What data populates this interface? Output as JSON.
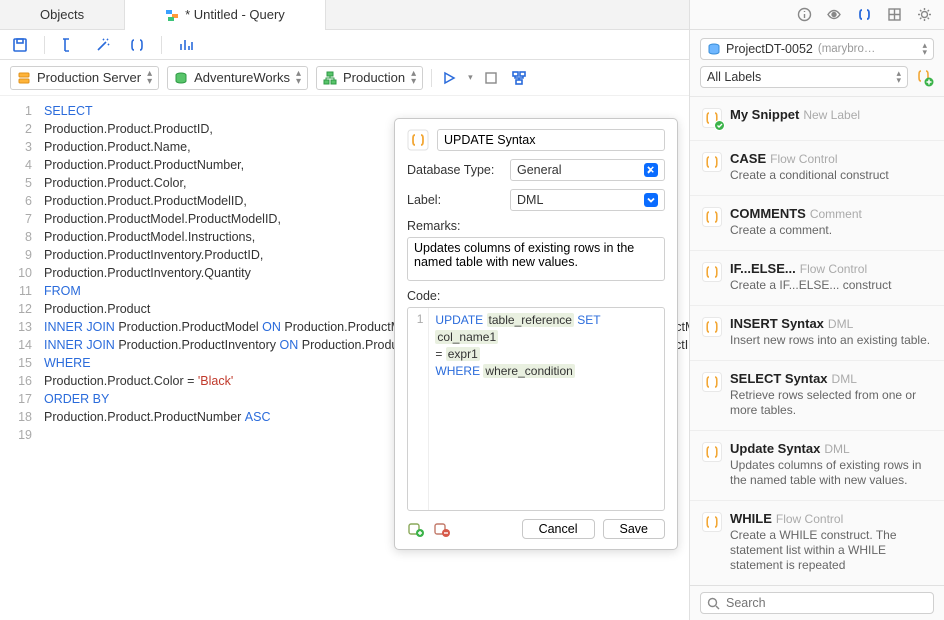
{
  "tabs": {
    "objects": "Objects",
    "query": "* Untitled - Query"
  },
  "toolbar2": {
    "connection": "Production Server",
    "database": "AdventureWorks",
    "schema": "Production"
  },
  "sql": {
    "lines": [
      {
        "n": 1,
        "pre": "",
        "kw": "SELECT",
        "post": ""
      },
      {
        "n": 2,
        "pre": "",
        "kw": "",
        "post": "Production.Product.ProductID,"
      },
      {
        "n": 3,
        "pre": "",
        "kw": "",
        "post": "Production.Product.Name,"
      },
      {
        "n": 4,
        "pre": "",
        "kw": "",
        "post": "Production.Product.ProductNumber,"
      },
      {
        "n": 5,
        "pre": "",
        "kw": "",
        "post": "Production.Product.Color,"
      },
      {
        "n": 6,
        "pre": "",
        "kw": "",
        "post": "Production.Product.ProductModelID,"
      },
      {
        "n": 7,
        "pre": "",
        "kw": "",
        "post": "Production.ProductModel.ProductModelID,"
      },
      {
        "n": 8,
        "pre": "",
        "kw": "",
        "post": "Production.ProductModel.Instructions,"
      },
      {
        "n": 9,
        "pre": "",
        "kw": "",
        "post": "Production.ProductInventory.ProductID,"
      },
      {
        "n": 10,
        "pre": "",
        "kw": "",
        "post": "Production.ProductInventory.Quantity"
      },
      {
        "n": 11,
        "pre": "",
        "kw": "FROM",
        "post": ""
      },
      {
        "n": 12,
        "pre": "",
        "kw": "",
        "post": "Production.Product"
      },
      {
        "n": 13,
        "pre": "",
        "kw": "INNER JOIN",
        "mid": " Production.ProductModel ",
        "kw2": "ON",
        "post": " Production.ProductModel.ProductModelID = Production.Product.ProductModelID"
      },
      {
        "n": 14,
        "pre": "",
        "kw": "INNER JOIN",
        "mid": " Production.ProductInventory ",
        "kw2": "ON",
        "post": " Production.ProductInventory.ProductID = Production.Product.ProductID"
      },
      {
        "n": 15,
        "pre": "",
        "kw": "WHERE",
        "post": ""
      },
      {
        "n": 16,
        "pre": "Production.Product.Color = ",
        "kw": "",
        "str": "'Black'",
        "post": ""
      },
      {
        "n": 17,
        "pre": "",
        "kw": "ORDER BY",
        "post": ""
      },
      {
        "n": 18,
        "pre": "Production.Product.ProductNumber ",
        "kw": "ASC",
        "post": ""
      },
      {
        "n": 19,
        "pre": "",
        "kw": "",
        "post": ""
      }
    ]
  },
  "popup": {
    "title": "UPDATE Syntax",
    "db_type_label": "Database Type:",
    "db_type_value": "General",
    "label_label": "Label:",
    "label_value": "DML",
    "remarks_label": "Remarks:",
    "remarks_value": "Updates columns of existing rows in the named table with new values.",
    "code_label": "Code:",
    "code": {
      "kw1": "UPDATE",
      "ph1": "table_reference",
      "kw2": "SET",
      "ph2": "col_name1",
      "eq": " = ",
      "ph3": "expr1",
      "kw3": "WHERE",
      "ph4": "where_condition"
    },
    "cancel": "Cancel",
    "save": "Save"
  },
  "right": {
    "project": "ProjectDT-0052",
    "project_user": "(marybro…",
    "labels_filter": "All Labels",
    "search_placeholder": "Search",
    "snippets": [
      {
        "title": "My Snippet",
        "tag": "New Label",
        "desc": "",
        "new": true
      },
      {
        "title": "CASE",
        "tag": "Flow Control",
        "desc": "Create a conditional construct"
      },
      {
        "title": "COMMENTS",
        "tag": "Comment",
        "desc": "Create a comment."
      },
      {
        "title": "IF...ELSE...",
        "tag": "Flow Control",
        "desc": "Create a IF...ELSE... construct"
      },
      {
        "title": "INSERT Syntax",
        "tag": "DML",
        "desc": "Insert new rows into an existing table."
      },
      {
        "title": "SELECT Syntax",
        "tag": "DML",
        "desc": "Retrieve rows selected from one or more tables."
      },
      {
        "title": "Update Syntax",
        "tag": "DML",
        "desc": "Updates columns of existing rows in the named table with new values."
      },
      {
        "title": "WHILE",
        "tag": "Flow Control",
        "desc": "Create a WHILE construct. The statement list within a WHILE statement is repeated"
      }
    ]
  }
}
